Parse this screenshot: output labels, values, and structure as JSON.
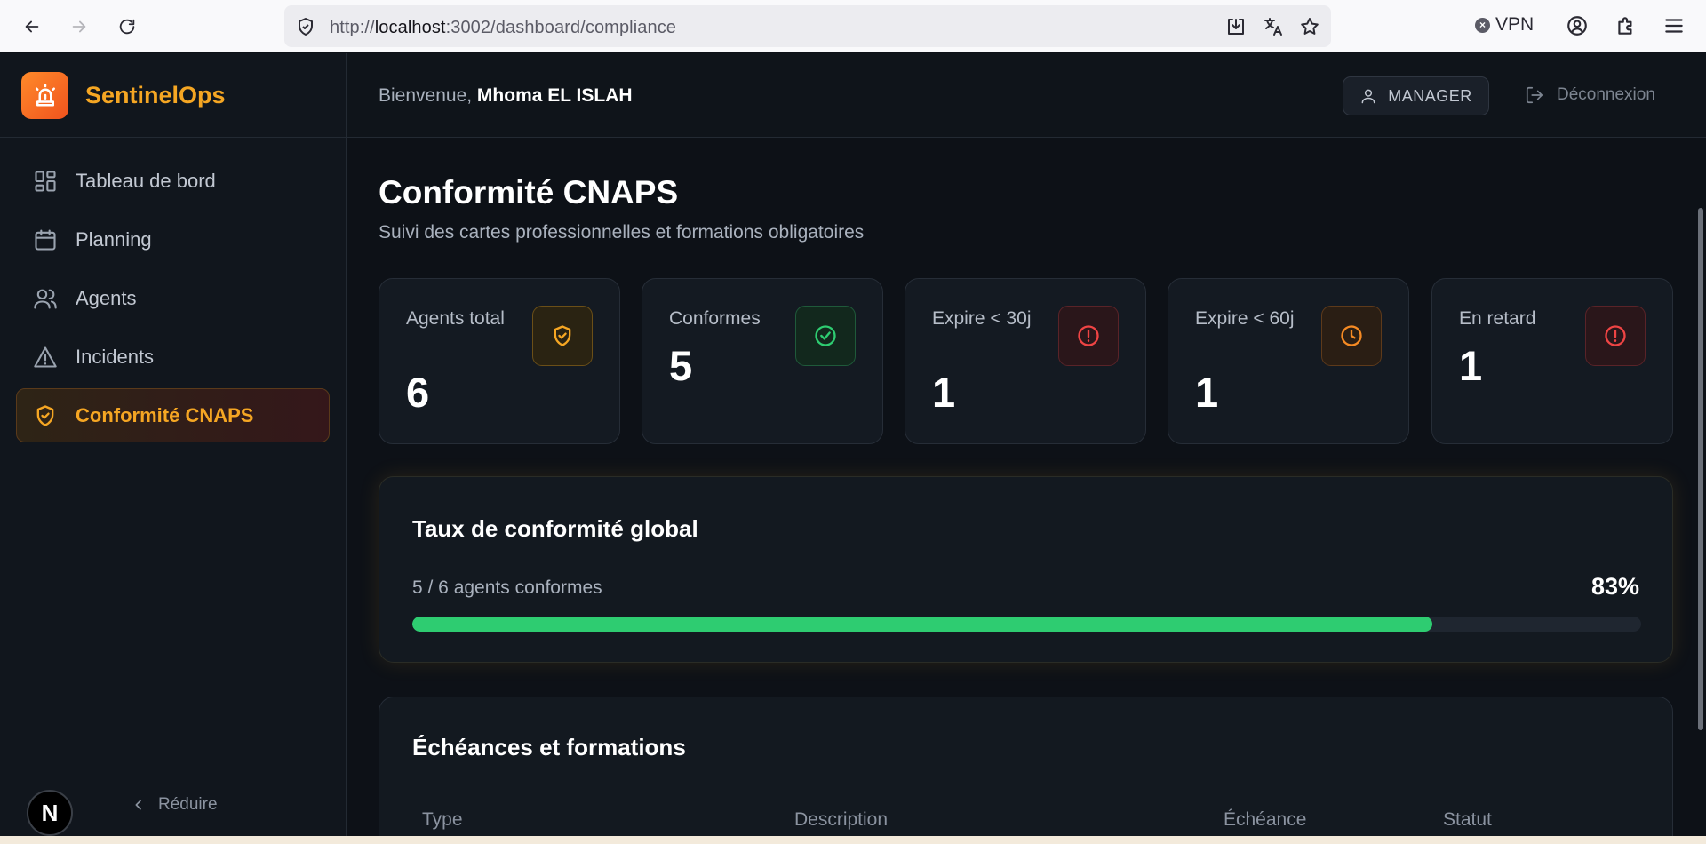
{
  "browser": {
    "url_prefix": "http://",
    "url_host": "localhost",
    "url_path": ":3002/dashboard/compliance",
    "vpn_label": "VPN"
  },
  "sidebar": {
    "brand": "SentinelOps",
    "items": [
      {
        "label": "Tableau de bord",
        "icon": "dashboard-grid-icon"
      },
      {
        "label": "Planning",
        "icon": "calendar-icon"
      },
      {
        "label": "Agents",
        "icon": "users-icon"
      },
      {
        "label": "Incidents",
        "icon": "warning-triangle-icon"
      },
      {
        "label": "Conformité CNAPS",
        "icon": "shield-check-icon",
        "active": true
      }
    ],
    "footer_badge": "N",
    "collapse_label": "Réduire"
  },
  "topbar": {
    "welcome_prefix": "Bienvenue, ",
    "user_name": "Mhoma EL ISLAH",
    "role": "MANAGER",
    "logout": "Déconnexion"
  },
  "page": {
    "title": "Conformité CNAPS",
    "subtitle": "Suivi des cartes professionnelles et formations obligatoires"
  },
  "stats": [
    {
      "label": "Agents total",
      "value": "6",
      "icon": "shield-check-icon",
      "color": "#f5a623"
    },
    {
      "label": "Conformes",
      "value": "5",
      "icon": "check-circle-icon",
      "color": "#2ecc71"
    },
    {
      "label": "Expire < 30j",
      "value": "1",
      "icon": "alert-circle-icon",
      "color": "#ef4444"
    },
    {
      "label": "Expire < 60j",
      "value": "1",
      "icon": "clock-icon",
      "color": "#f58a23"
    },
    {
      "label": "En retard",
      "value": "1",
      "icon": "alert-circle-icon",
      "color": "#ef4444"
    }
  ],
  "compliance": {
    "title": "Taux de conformité global",
    "summary": "5 / 6 agents conformes",
    "percent_label": "83%",
    "ratio": 0.83,
    "bar_color": "#2ecc71"
  },
  "deadlines": {
    "title": "Échéances et formations",
    "columns": [
      "Type",
      "Description",
      "Échéance",
      "Statut"
    ]
  }
}
